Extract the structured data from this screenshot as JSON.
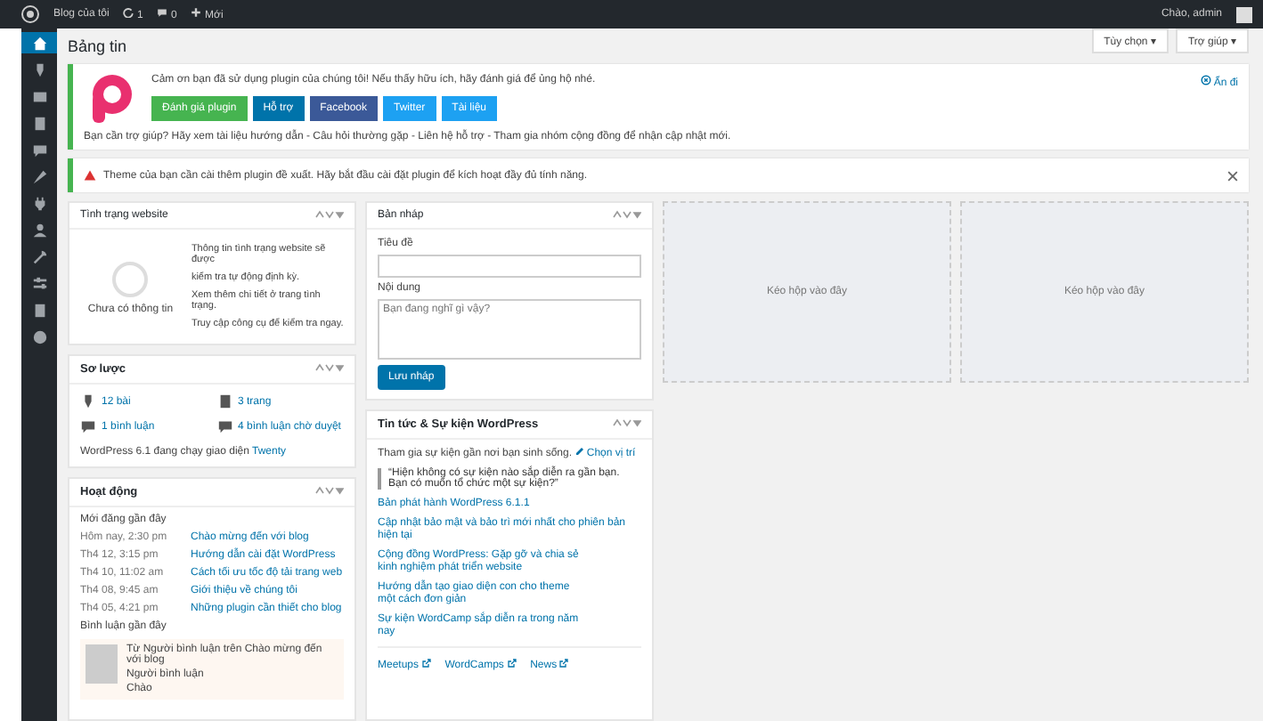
{
  "admin_bar": {
    "site_name": "Blog của tôi",
    "updates": "1",
    "comments": "0",
    "new": "Mới",
    "greeting": "Chào, admin"
  },
  "sidebar": {
    "items": [
      {
        "kind": "house",
        "selected": true
      },
      {
        "kind": "pin",
        "selected": false
      },
      {
        "kind": "image",
        "selected": false
      },
      {
        "kind": "page",
        "selected": false
      },
      {
        "kind": "bubble",
        "selected": false
      },
      {
        "kind": "brush",
        "selected": false
      },
      {
        "kind": "plug",
        "selected": false
      },
      {
        "kind": "person",
        "selected": false
      },
      {
        "kind": "wrench",
        "selected": false
      },
      {
        "kind": "sliders",
        "selected": false
      },
      {
        "kind": "page",
        "selected": false
      },
      {
        "kind": "circle",
        "selected": false
      }
    ]
  },
  "screen_tabs": [
    "Tùy chọn ▾",
    "Trợ giúp ▾"
  ],
  "page_title": "Bảng tin",
  "plugin_notice": {
    "text": "Cảm ơn bạn đã sử dụng plugin của chúng tôi! Nếu thấy hữu ích, hãy đánh giá để ủng hộ nhé.",
    "dismiss": "Ẩn đi",
    "buttons": [
      {
        "label": "Đánh giá plugin",
        "kind": "green"
      },
      {
        "label": "Hỗ trợ",
        "kind": "blue"
      },
      {
        "label": "Facebook",
        "kind": "navy"
      },
      {
        "label": "Twitter",
        "kind": "sky"
      },
      {
        "label": "Tài liệu",
        "kind": "sky"
      }
    ],
    "footer": "Bạn cần trợ giúp? Hãy xem tài liệu hướng dẫn - Câu hỏi thường gặp - Liên hệ hỗ trợ - Tham gia nhóm cộng đồng để nhận cập nhật mới."
  },
  "warning_notice": {
    "text": "Theme của bạn cần cài thêm plugin đề xuất. Hãy bắt đầu cài đặt plugin để kích hoạt đầy đủ tính năng."
  },
  "site_health": {
    "title": "Tình trạng website",
    "status": "Chưa có thông tin",
    "lines": [
      "Thông tin tình trạng website sẽ được",
      "kiểm tra tự động định kỳ.",
      "Xem thêm chi tiết ở trang tình trạng.",
      "Truy cập công cụ để kiểm tra ngay."
    ]
  },
  "glance": {
    "title": "Sơ lược",
    "items": [
      {
        "kind": "pin",
        "text": "12 bài"
      },
      {
        "kind": "page",
        "text": "3 trang"
      },
      {
        "kind": "bubble",
        "text": "1 bình luận"
      },
      {
        "kind": "bubble",
        "text": "4 bình luận chờ duyệt"
      }
    ],
    "footer": "WordPress 6.1 đang chạy giao diện",
    "footer_link": "Twenty"
  },
  "activity": {
    "title": "Hoạt động",
    "recent_heading": "Mới đăng gần đây",
    "posts": [
      {
        "date": "Hôm nay, 2:30 pm",
        "title": "Chào mừng đến với blog"
      },
      {
        "date": "Th4 12, 3:15 pm",
        "title": "Hướng dẫn cài đặt WordPress"
      },
      {
        "date": "Th4 10, 11:02 am",
        "title": "Cách tối ưu tốc độ tải trang web"
      },
      {
        "date": "Th4 08, 9:45 am",
        "title": "Giới thiệu về chúng tôi"
      },
      {
        "date": "Th4 05, 4:21 pm",
        "title": "Những plugin cần thiết cho blog"
      }
    ],
    "comments_heading": "Bình luận gần đây",
    "comment": {
      "meta": "Từ Người bình luận trên Chào mừng đến với blog",
      "author": "Người bình luận",
      "text": "Chào"
    }
  },
  "quick_draft": {
    "title": "Bản nháp",
    "title_label": "Tiêu đề",
    "content_label": "Nội dung",
    "content_placeholder": "Bạn đang nghĩ gì vậy?",
    "save": "Lưu nháp"
  },
  "news": {
    "title": "Tin tức & Sự kiện WordPress",
    "intro": "Tham gia sự kiện gần nơi bạn sinh sống.",
    "intro_link": "Chọn vị trí",
    "highlight": "“Hiện không có sự kiện nào sắp diễn ra gần bạn. Bạn có muốn tổ chức một sự kiện?”",
    "items": [
      {
        "title": "Bản phát hành WordPress 6.1.1"
      },
      {
        "title": "Cập nhật bảo mật và bảo trì mới nhất cho phiên bản",
        "sub": "hiện tại"
      },
      {
        "title": "Cộng đồng WordPress: Gặp gỡ và chia sẻ",
        "sub": "kinh nghiệm phát triển website"
      },
      {
        "title": "Hướng dẫn tạo giao diện con cho theme",
        "sub": "một cách đơn giản"
      },
      {
        "title": "Sự kiện WordCamp sắp diễn ra trong năm",
        "sub": "nay"
      }
    ],
    "links": [
      "Meetups",
      "WordCamps",
      "News"
    ]
  },
  "placeholders": [
    "Kéo hộp vào đây",
    "Kéo hộp vào đây"
  ]
}
